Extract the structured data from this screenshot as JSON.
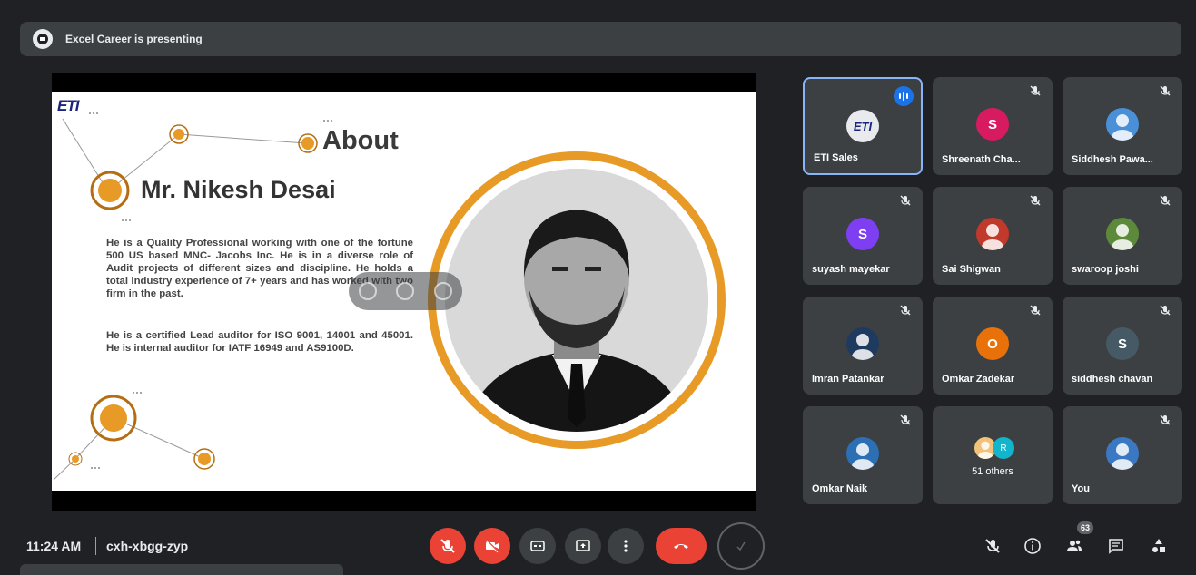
{
  "banner": {
    "text": "Excel Career is presenting",
    "icon": "presenter-avatar-icon"
  },
  "slide": {
    "logo": "ETI",
    "about_heading": "About",
    "name": "Mr. Nikesh Desai",
    "paragraph1": "He is a Quality Professional working with one of the fortune 500 US based MNC- Jacobs Inc. He is in a diverse role of Audit projects of different sizes and discipline. He holds a total industry experience of 7+ years and has worked with two firm in the past.",
    "paragraph2": "He is a certified Lead auditor for ISO 9001, 14001 and 45001. He is internal auditor for IATF 16949 and AS9100D.",
    "accent_color": "#e79a25"
  },
  "participants": [
    {
      "name": "ETI Sales",
      "avatar": "ETI",
      "avatar_color": "#e8eaed",
      "speaking": true
    },
    {
      "name": "Shreenath Cha...",
      "avatar": "S",
      "avatar_color": "#d81b60"
    },
    {
      "name": "Siddhesh Pawa...",
      "avatar": "",
      "avatar_color": "#4a90d9"
    },
    {
      "name": "suyash mayekar",
      "avatar": "S",
      "avatar_color": "#7e3ff2"
    },
    {
      "name": "Sai Shigwan",
      "avatar": "",
      "avatar_color": "#c0392b"
    },
    {
      "name": "swaroop joshi",
      "avatar": "",
      "avatar_color": "#5d8a3a"
    },
    {
      "name": "Imran Patankar",
      "avatar": "",
      "avatar_color": "#1e3a5f"
    },
    {
      "name": "Omkar Zadekar",
      "avatar": "O",
      "avatar_color": "#e8710a"
    },
    {
      "name": "siddhesh chavan",
      "avatar": "S",
      "avatar_color": "#455a64"
    },
    {
      "name": "Omkar Naik",
      "avatar": "",
      "avatar_color": "#2c6fb5"
    },
    {
      "name": "51 others",
      "avatar": "",
      "avatar_color": "#12b5cb"
    },
    {
      "name": "You",
      "avatar": "",
      "avatar_color": "#3b78c4"
    }
  ],
  "others_mini_avatar": "R",
  "bottom": {
    "time": "11:24 AM",
    "separator": "|",
    "meeting_code": "cxh-xbgg-zyp",
    "participants_count": "63"
  }
}
